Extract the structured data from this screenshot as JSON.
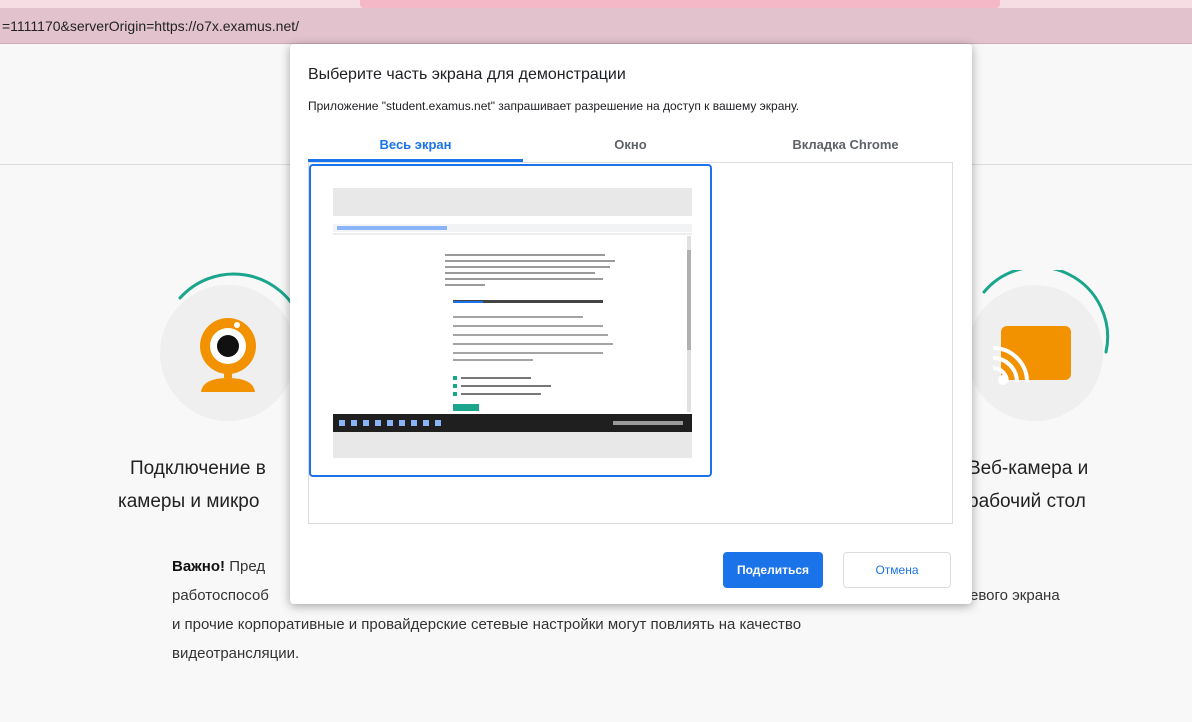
{
  "browser": {
    "url": "=1111170&serverOrigin=https://o7x.examus.net/"
  },
  "page": {
    "left_title_line1": "Подключение в",
    "left_title_line2": "камеры и микро",
    "right_title_line1": "Веб-камера и",
    "right_title_line2": "рабочий стол",
    "note_bold": "Важно!",
    "note_line1": " Пред",
    "note_line2a": "работоспособ",
    "note_line2b": "евого экрана",
    "note_line3": "и прочие корпоративные и провайдерские сетевые настройки могут повлиять на качество",
    "note_line4": "видеотрансляции."
  },
  "dialog": {
    "title": "Выберите часть экрана для демонстрации",
    "subtitle": "Приложение \"student.examus.net\" запрашивает разрешение на доступ к вашему экрану.",
    "tabs": [
      {
        "label": "Весь экран",
        "active": true
      },
      {
        "label": "Окно",
        "active": false
      },
      {
        "label": "Вкладка Chrome",
        "active": false
      }
    ],
    "share_button": "Поделиться",
    "cancel_button": "Отмена"
  },
  "colors": {
    "accent": "#1a73e8",
    "orange": "#f39200",
    "teal": "#1aa58c"
  },
  "icons": [
    "webcam-icon",
    "screen-cast-icon"
  ]
}
